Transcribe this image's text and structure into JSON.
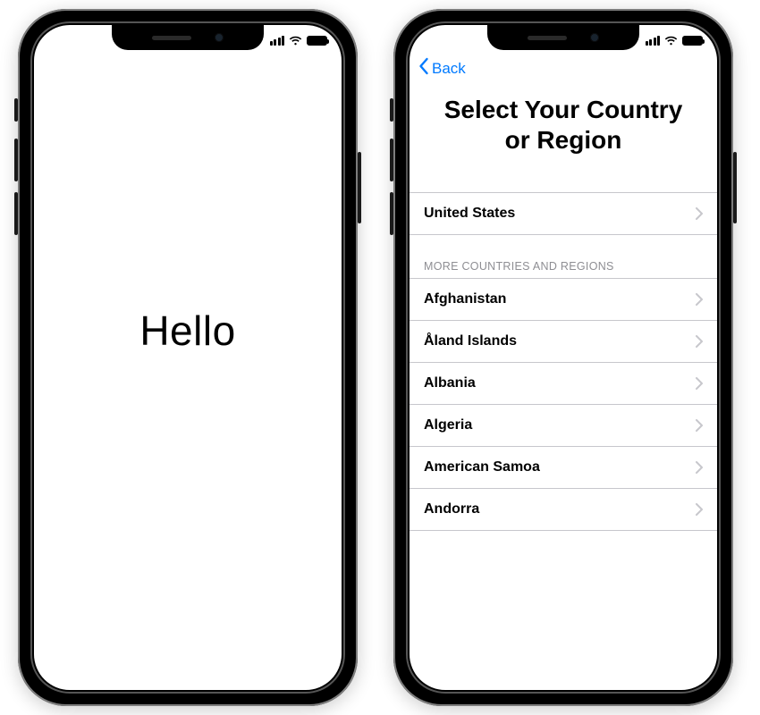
{
  "phone1": {
    "hello": "Hello"
  },
  "phone2": {
    "back_label": "Back",
    "title_line1": "Select Your Country",
    "title_line2": "or Region",
    "primary_country": "United States",
    "more_header": "MORE COUNTRIES AND REGIONS",
    "countries": [
      "Afghanistan",
      "Åland Islands",
      "Albania",
      "Algeria",
      "American Samoa",
      "Andorra"
    ]
  }
}
